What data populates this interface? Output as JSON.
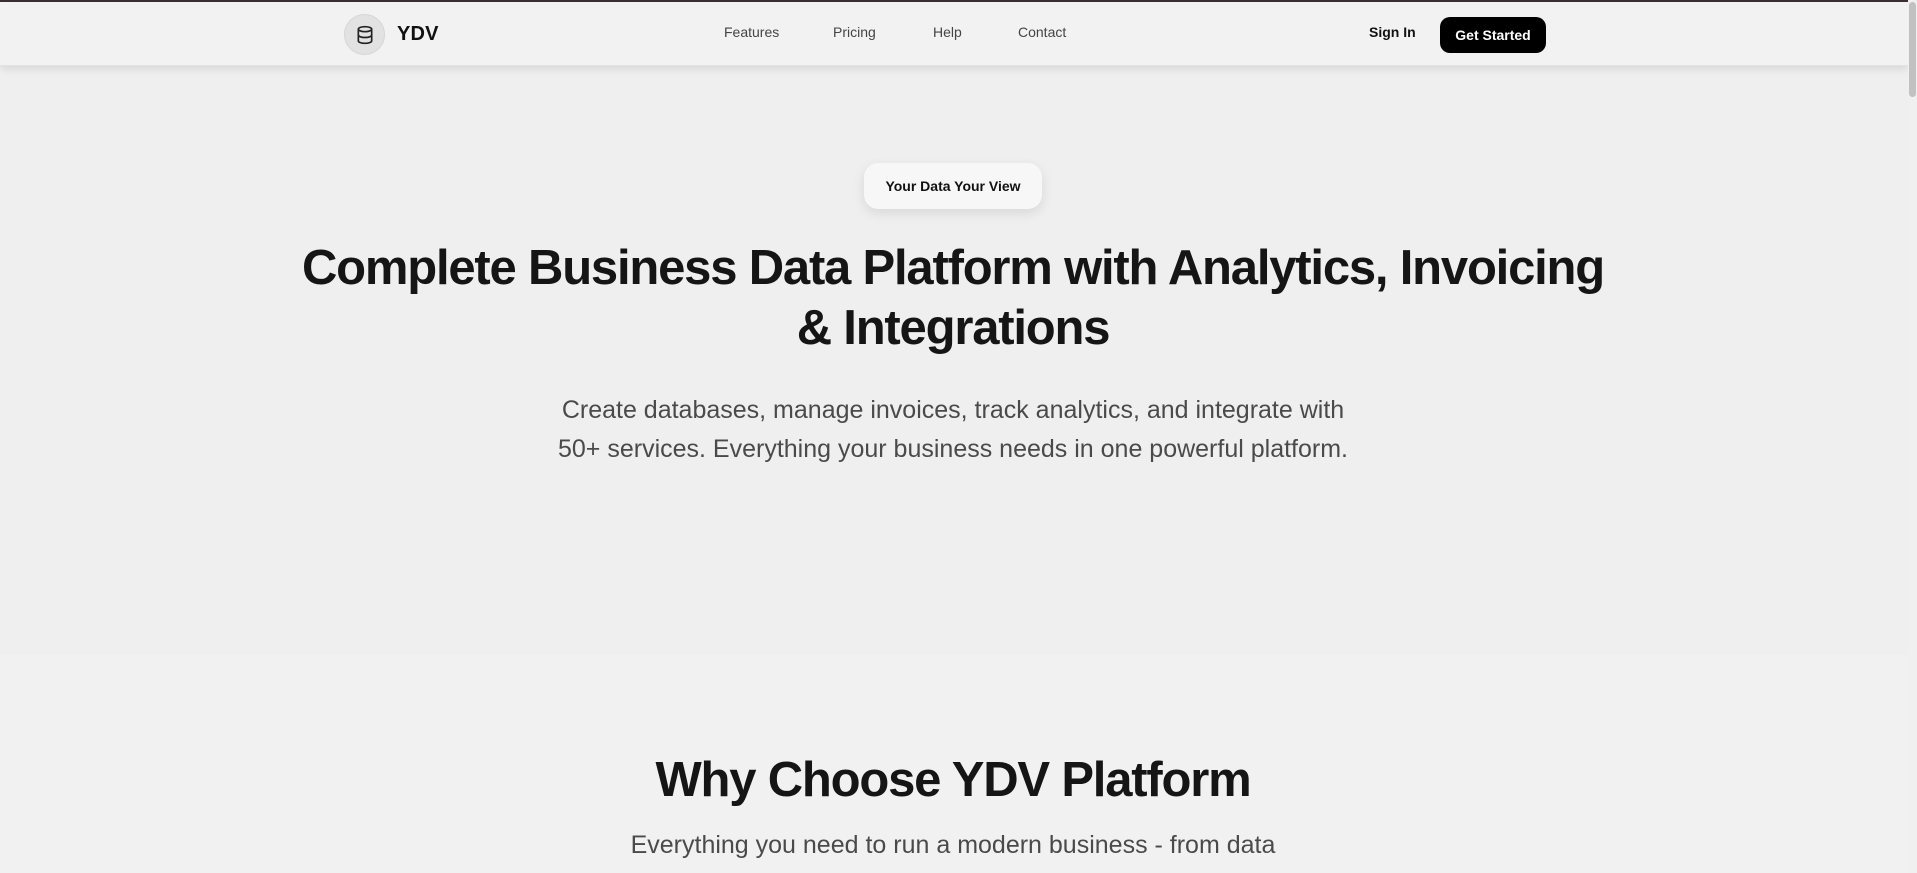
{
  "brand": {
    "name": "YDV",
    "logo_icon": "database-icon"
  },
  "nav": {
    "links": [
      "Features",
      "Pricing",
      "Help",
      "Contact"
    ],
    "sign_in": "Sign In",
    "get_started": "Get Started"
  },
  "hero": {
    "badge": "Your Data Your View",
    "title": "Complete Business Data Platform with Analytics, Invoicing & Integrations",
    "subtitle": "Create databases, manage invoices, track analytics, and integrate with 50+ services. Everything your business needs in one powerful platform."
  },
  "why": {
    "title": "Why Choose YDV Platform",
    "subtitle": "Everything you need to run a modern business - from data"
  },
  "colors": {
    "background": "#efefef",
    "primary_button": "#000000",
    "text": "#151515"
  }
}
